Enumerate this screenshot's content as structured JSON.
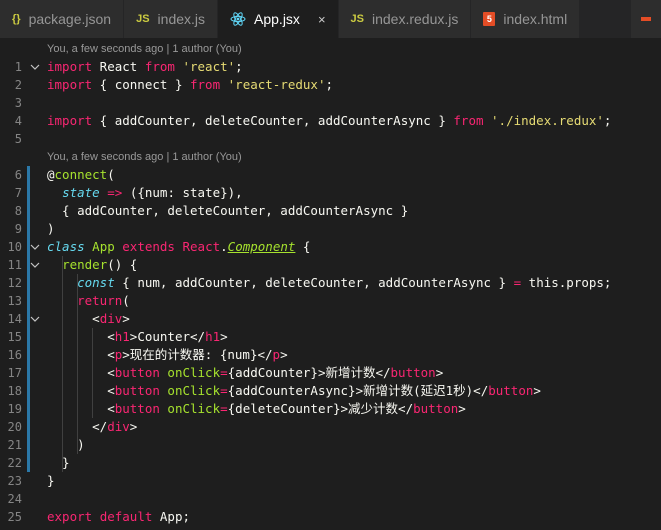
{
  "tabs": [
    {
      "label": "package.json",
      "icon": "json-icon",
      "active": false
    },
    {
      "label": "index.js",
      "icon": "js-icon",
      "active": false
    },
    {
      "label": "App.jsx",
      "icon": "react-icon",
      "active": true
    },
    {
      "label": "index.redux.js",
      "icon": "js-icon",
      "active": false
    },
    {
      "label": "index.html",
      "icon": "html5-icon",
      "active": false
    }
  ],
  "close_glyph": "×",
  "tab_icons": {
    "js": "JS",
    "html5": "5"
  },
  "codelens": [
    "You, a few seconds ago | 1 author (You)",
    "You, a few seconds ago | 1 author (You)"
  ],
  "code_lines": [
    {
      "n": "1",
      "tokens": [
        [
          "import",
          "s-kw"
        ],
        [
          " React ",
          "s-plain"
        ],
        [
          "from",
          "s-kw"
        ],
        [
          " ",
          "s-plain"
        ],
        [
          "'react'",
          "s-str"
        ],
        [
          ";",
          "s-plain"
        ]
      ]
    },
    {
      "n": "2",
      "tokens": [
        [
          "import",
          "s-kw"
        ],
        [
          " { connect } ",
          "s-plain"
        ],
        [
          "from",
          "s-kw"
        ],
        [
          " ",
          "s-plain"
        ],
        [
          "'react-redux'",
          "s-str"
        ],
        [
          ";",
          "s-plain"
        ]
      ]
    },
    {
      "n": "3",
      "tokens": []
    },
    {
      "n": "4",
      "tokens": [
        [
          "import",
          "s-kw"
        ],
        [
          " { addCounter, deleteCounter, addCounterAsync } ",
          "s-plain"
        ],
        [
          "from",
          "s-kw"
        ],
        [
          " ",
          "s-plain"
        ],
        [
          "'./index.redux'",
          "s-str"
        ],
        [
          ";",
          "s-plain"
        ]
      ]
    },
    {
      "n": "5",
      "tokens": []
    },
    {
      "n": "6",
      "tokens": [
        [
          "@",
          "s-plain"
        ],
        [
          "connect",
          "s-fn"
        ],
        [
          "(",
          "s-plain"
        ]
      ]
    },
    {
      "n": "7",
      "tokens": [
        [
          "  ",
          "s-plain"
        ],
        [
          "state",
          "s-blue"
        ],
        [
          " ",
          "s-plain"
        ],
        [
          "=>",
          "s-kw"
        ],
        [
          " ({num: state}),",
          "s-plain"
        ]
      ]
    },
    {
      "n": "8",
      "tokens": [
        [
          "  { addCounter, deleteCounter, addCounterAsync }",
          "s-plain"
        ]
      ]
    },
    {
      "n": "9",
      "tokens": [
        [
          ")",
          "s-plain"
        ]
      ]
    },
    {
      "n": "10",
      "tokens": [
        [
          "class",
          "s-blue"
        ],
        [
          " ",
          "s-plain"
        ],
        [
          "App",
          "s-green"
        ],
        [
          " ",
          "s-plain"
        ],
        [
          "extends",
          "s-kw"
        ],
        [
          " ",
          "s-plain"
        ],
        [
          "React",
          "s-kw"
        ],
        [
          ".",
          "s-plain"
        ],
        [
          "Component",
          "s-under"
        ],
        [
          " {",
          "s-plain"
        ]
      ]
    },
    {
      "n": "11",
      "tokens": [
        [
          "  ",
          "s-plain"
        ],
        [
          "render",
          "s-fn"
        ],
        [
          "() {",
          "s-plain"
        ]
      ]
    },
    {
      "n": "12",
      "tokens": [
        [
          "    ",
          "s-plain"
        ],
        [
          "const",
          "s-blue"
        ],
        [
          " { num, addCounter, deleteCounter, addCounterAsync } ",
          "s-plain"
        ],
        [
          "=",
          "s-kw"
        ],
        [
          " this.props;",
          "s-plain"
        ]
      ]
    },
    {
      "n": "13",
      "tokens": [
        [
          "    ",
          "s-plain"
        ],
        [
          "return",
          "s-kw"
        ],
        [
          "(",
          "s-plain"
        ]
      ]
    },
    {
      "n": "14",
      "tokens": [
        [
          "      <",
          "s-plain"
        ],
        [
          "div",
          "s-tag"
        ],
        [
          ">",
          "s-plain"
        ]
      ]
    },
    {
      "n": "15",
      "tokens": [
        [
          "        <",
          "s-plain"
        ],
        [
          "h1",
          "s-tag"
        ],
        [
          ">Counter</",
          "s-plain"
        ],
        [
          "h1",
          "s-tag"
        ],
        [
          ">",
          "s-plain"
        ]
      ]
    },
    {
      "n": "16",
      "tokens": [
        [
          "        <",
          "s-plain"
        ],
        [
          "p",
          "s-tag"
        ],
        [
          ">现在的计数器: {num}</",
          "s-plain"
        ],
        [
          "p",
          "s-tag"
        ],
        [
          ">",
          "s-plain"
        ]
      ]
    },
    {
      "n": "17",
      "tokens": [
        [
          "        <",
          "s-plain"
        ],
        [
          "button",
          "s-tag"
        ],
        [
          " ",
          "s-plain"
        ],
        [
          "onClick",
          "s-attr"
        ],
        [
          "=",
          "s-kw"
        ],
        [
          "{addCounter}>新增计数</",
          "s-plain"
        ],
        [
          "button",
          "s-tag"
        ],
        [
          ">",
          "s-plain"
        ]
      ]
    },
    {
      "n": "18",
      "tokens": [
        [
          "        <",
          "s-plain"
        ],
        [
          "button",
          "s-tag"
        ],
        [
          " ",
          "s-plain"
        ],
        [
          "onClick",
          "s-attr"
        ],
        [
          "=",
          "s-kw"
        ],
        [
          "{addCounterAsync}>新增计数(延迟1秒)</",
          "s-plain"
        ],
        [
          "button",
          "s-tag"
        ],
        [
          ">",
          "s-plain"
        ]
      ]
    },
    {
      "n": "19",
      "tokens": [
        [
          "        <",
          "s-plain"
        ],
        [
          "button",
          "s-tag"
        ],
        [
          " ",
          "s-plain"
        ],
        [
          "onClick",
          "s-attr"
        ],
        [
          "=",
          "s-kw"
        ],
        [
          "{deleteCounter}>减少计数</",
          "s-plain"
        ],
        [
          "button",
          "s-tag"
        ],
        [
          ">",
          "s-plain"
        ]
      ]
    },
    {
      "n": "20",
      "tokens": [
        [
          "      </",
          "s-plain"
        ],
        [
          "div",
          "s-tag"
        ],
        [
          ">",
          "s-plain"
        ]
      ]
    },
    {
      "n": "21",
      "tokens": [
        [
          "    )",
          "s-plain"
        ]
      ]
    },
    {
      "n": "22",
      "tokens": [
        [
          "  }",
          "s-plain"
        ]
      ]
    },
    {
      "n": "23",
      "tokens": [
        [
          "}",
          "s-plain"
        ]
      ]
    },
    {
      "n": "24",
      "tokens": []
    },
    {
      "n": "25",
      "tokens": [
        [
          "export",
          "s-kw"
        ],
        [
          " ",
          "s-plain"
        ],
        [
          "default",
          "s-kw"
        ],
        [
          " App;",
          "s-plain"
        ]
      ]
    }
  ],
  "folds": [
    "1",
    "10",
    "11",
    "14"
  ]
}
